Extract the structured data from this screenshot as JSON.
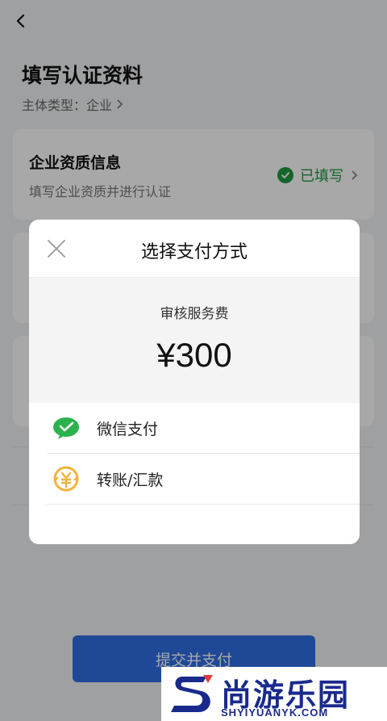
{
  "page": {
    "title": "填写认证资料",
    "subject_type": "主体类型：企业",
    "cards": [
      {
        "title": "企业资质信息",
        "subtitle": "填写企业资质并进行认证",
        "status": "已填写"
      }
    ],
    "submit_label": "提交并支付"
  },
  "modal": {
    "title": "选择支付方式",
    "fee_label": "审核服务费",
    "fee_amount": "¥300",
    "payment_methods": [
      {
        "label": "微信支付",
        "icon": "wechat-pay-icon"
      },
      {
        "label": "转账/汇款",
        "icon": "transfer-icon"
      }
    ]
  },
  "watermark": {
    "brand": "尚游乐园",
    "domain": "SHYIYUANYK.COM"
  },
  "colors": {
    "success": "#1f9a3f",
    "primary": "#2f6fe6",
    "wechat": "#2bb24c",
    "transfer": "#f2b33d",
    "watermark": "#1a2a8c"
  }
}
